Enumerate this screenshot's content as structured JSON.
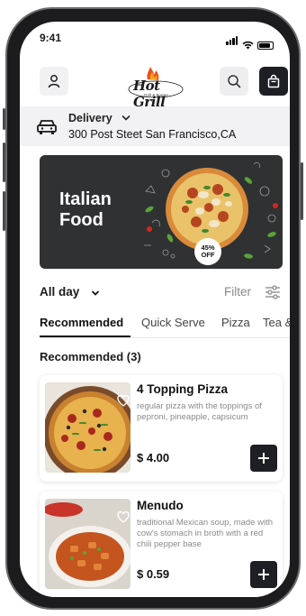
{
  "status": {
    "time": "9:41"
  },
  "header": {
    "logo_text": "Hot Grill",
    "logo_sub": "Grill & Burger"
  },
  "delivery": {
    "label": "Delivery",
    "address": "300 Post Steet San Francisco,CA"
  },
  "banner": {
    "title": "Italian Food",
    "discount_value": "45%",
    "discount_label": "OFF"
  },
  "filter": {
    "time_selector": "All day",
    "filter_label": "Filter"
  },
  "tabs": [
    {
      "label": "Recommended",
      "active": true
    },
    {
      "label": "Quick Serve",
      "active": false
    },
    {
      "label": "Pizza",
      "active": false
    },
    {
      "label": "Tea &",
      "active": false
    }
  ],
  "section": {
    "title": "Recommended (3)"
  },
  "products": [
    {
      "name": "4 Topping Pizza",
      "description": "regular pizza with the toppings of peproni, pineapple, capsicum",
      "price": "$ 4.00"
    },
    {
      "name": "Menudo",
      "description": "traditional Mexican soup, made with cow's stomach in broth with a red chili pepper base",
      "price": "$ 0.59"
    }
  ],
  "colors": {
    "primary_dark": "#1d1f24",
    "banner_bg": "#2f3133",
    "muted_text": "#8a8a8a",
    "delivery_bg": "#f2f2f4"
  },
  "icons": [
    "user-icon",
    "search-icon",
    "shopping-bag-icon",
    "car-icon",
    "chevron-down-icon",
    "filter-sliders-icon",
    "heart-icon",
    "plus-icon"
  ]
}
